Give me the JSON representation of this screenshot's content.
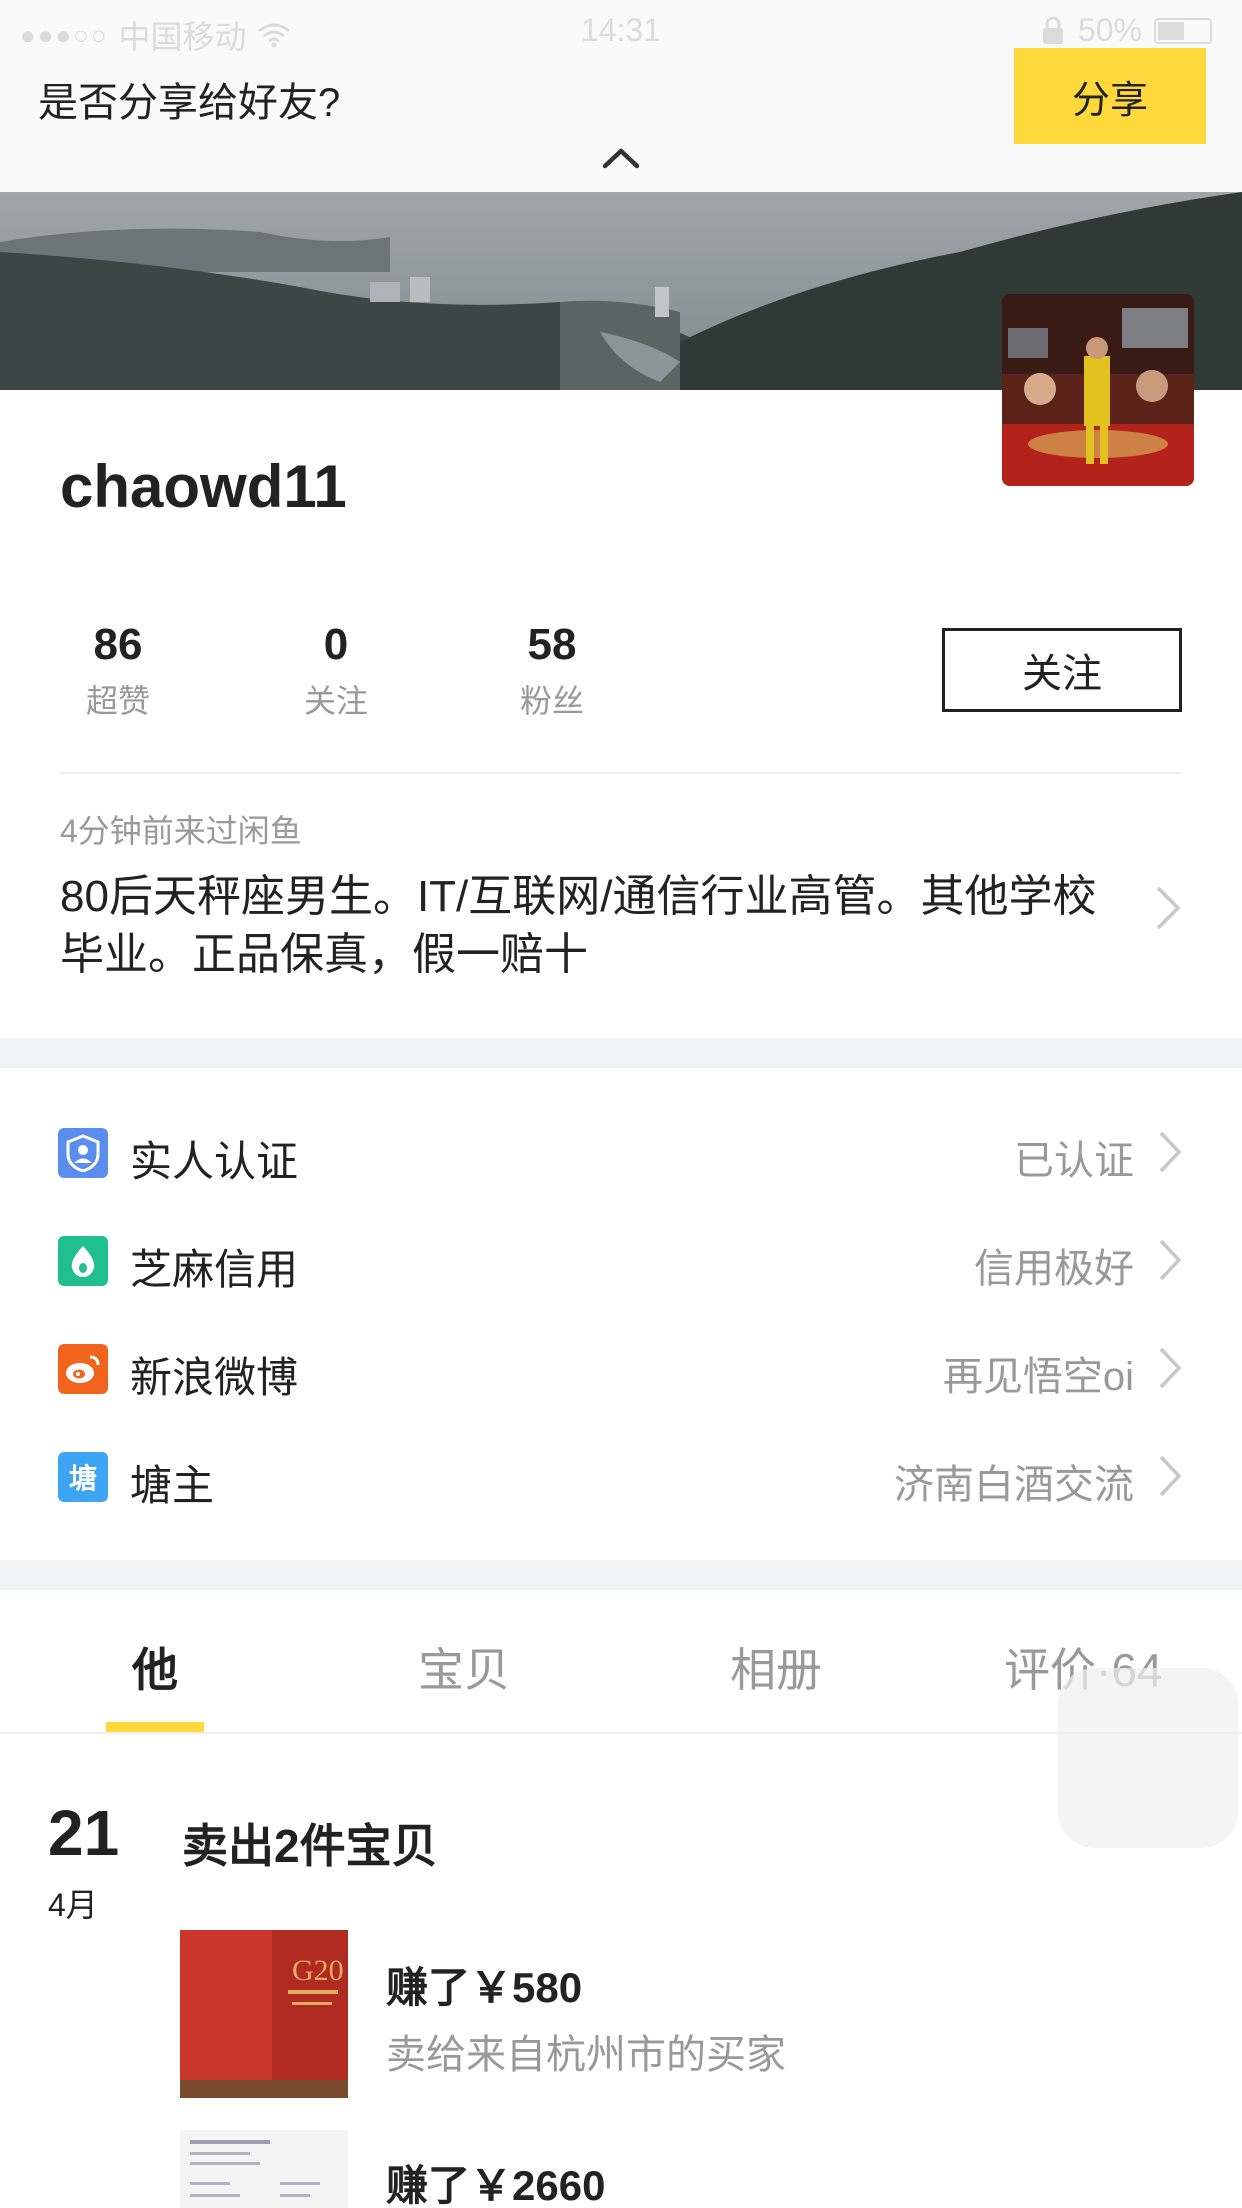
{
  "status_bar": {
    "carrier": "中国移动",
    "time": "14:31",
    "battery": "50%"
  },
  "share_banner": {
    "prompt": "是否分享给好友?",
    "share_label": "分享"
  },
  "profile": {
    "username": "chaowd11",
    "follow_label": "关注"
  },
  "stats": [
    {
      "value": "86",
      "label": "超赞"
    },
    {
      "value": "0",
      "label": "关注"
    },
    {
      "value": "58",
      "label": "粉丝"
    }
  ],
  "last_visit": "4分钟前来过闲鱼",
  "bio": "80后天秤座男生。IT/互联网/通信行业高管。其他学校毕业。正品保真，假一赔十",
  "verifications": [
    {
      "icon": "real-person-icon",
      "label": "实人认证",
      "value": "已认证",
      "color": "#5b8def"
    },
    {
      "icon": "sesame-credit-icon",
      "label": "芝麻信用",
      "value": "信用极好",
      "color": "#1fbf8f"
    },
    {
      "icon": "weibo-icon",
      "label": "新浪微博",
      "value": "再见悟空oi",
      "color": "#f0641e"
    },
    {
      "icon": "pond-icon",
      "label": "塘主",
      "value": "济南白酒交流",
      "color": "#3ea5f5",
      "glyph": "塘"
    }
  ],
  "tabs": [
    {
      "label": "他",
      "active": true
    },
    {
      "label": "宝贝",
      "active": false
    },
    {
      "label": "相册",
      "active": false
    },
    {
      "label": "评价·64",
      "active": false
    }
  ],
  "timeline": {
    "day": "21",
    "month": "4月",
    "title": "卖出2件宝贝",
    "items": [
      {
        "earned": "赚了￥580",
        "buyer": "卖给来自杭州市的买家"
      },
      {
        "earned": "赚了￥2660"
      }
    ]
  },
  "colors": {
    "accent": "#ffd93b",
    "muted_text": "#999999",
    "band": "#f2f3f7"
  }
}
